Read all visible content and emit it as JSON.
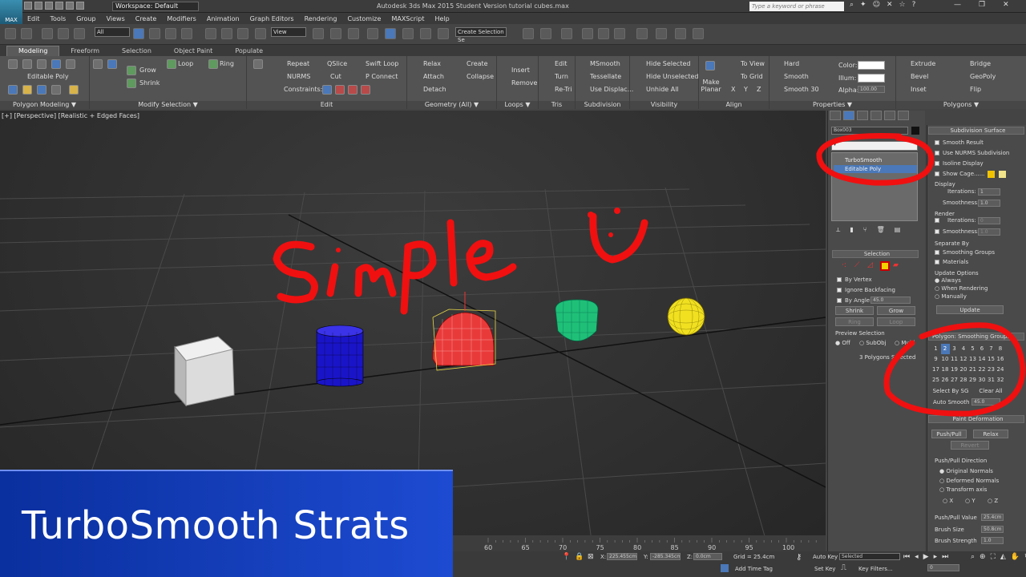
{
  "app": {
    "logo": "MAX",
    "workspace": "Workspace: Default",
    "title": "Autodesk 3ds Max  2015    Student Version    tutorial cubes.max",
    "search_placeholder": "Type a keyword or phrase"
  },
  "menu": [
    "Edit",
    "Tools",
    "Group",
    "Views",
    "Create",
    "Modifiers",
    "Animation",
    "Graph Editors",
    "Rendering",
    "Customize",
    "MAXScript",
    "Help"
  ],
  "toolbar": {
    "filter": "All",
    "ref_coord": "View",
    "selection_set": "Create Selection Se"
  },
  "ribbon_tabs": [
    "Modeling",
    "Freeform",
    "Selection",
    "Object Paint",
    "Populate"
  ],
  "ribbon": {
    "polygon_modeling": {
      "label": "Editable Poly",
      "footer": "Polygon Modeling ▼"
    },
    "modify_selection": {
      "grow": "Grow",
      "shrink": "Shrink",
      "loop": "Loop",
      "ring": "Ring",
      "footer": "Modify Selection ▼"
    },
    "edit": {
      "repeat": "Repeat",
      "qslice": "QSlice",
      "swift_loop": "Swift Loop",
      "nurms": "NURMS",
      "cut": "Cut",
      "p_connect": "P Connect",
      "constraints": "Constraints:",
      "footer": "Edit"
    },
    "geometry": {
      "relax": "Relax",
      "create": "Create",
      "attach": "Attach",
      "collapse": "Collapse",
      "detach": "Detach",
      "footer": "Geometry (All) ▼"
    },
    "loops": {
      "insert": "Insert",
      "remove": "Remove",
      "footer": "Loops ▼"
    },
    "tris": {
      "edit": "Edit",
      "turn": "Turn",
      "retri": "Re-Tri",
      "footer": "Tris"
    },
    "subdivision": {
      "msmooth": "MSmooth",
      "tessellate": "Tessellate",
      "use_displac": "Use Displac...",
      "footer": "Subdivision"
    },
    "visibility": {
      "hide_selected": "Hide Selected",
      "hide_unselected": "Hide Unselected",
      "unhide_all": "Unhide All",
      "footer": "Visibility"
    },
    "align": {
      "make_planar": "Make Planar",
      "to_view": "To View",
      "to_grid": "To Grid",
      "x": "X",
      "y": "Y",
      "z": "Z",
      "footer": "Align"
    },
    "properties": {
      "hard": "Hard",
      "smooth": "Smooth",
      "smooth30": "Smooth 30",
      "color": "Color:",
      "illum": "Illum:",
      "alpha": "Alpha:",
      "alpha_val": "100.00",
      "footer": "Properties ▼"
    },
    "polygons": {
      "extrude": "Extrude",
      "bridge": "Bridge",
      "bevel": "Bevel",
      "geopoly": "GeoPoly",
      "inset": "Inset",
      "flip": "Flip",
      "footer": "Polygons ▼"
    }
  },
  "viewport": {
    "label": "[+] [Perspective] [Realistic + Edged Faces]",
    "annotation": "simple"
  },
  "command_panel": {
    "object_name": "Box003",
    "modifiers": [
      "TurboSmooth",
      "Editable Poly"
    ],
    "selection": {
      "title": "Selection",
      "by_vertex": "By Vertex",
      "ignore_backfacing": "Ignore Backfacing",
      "by_angle": "By Angle:",
      "by_angle_val": "45.0",
      "shrink": "Shrink",
      "grow": "Grow",
      "ring": "Ring",
      "loop": "Loop",
      "preview_selection": "Preview Selection",
      "off": "Off",
      "subobj": "SubObj",
      "multi": "Multi",
      "status": "3 Polygons Selected"
    }
  },
  "rollout": {
    "subdivision_surface": {
      "title": "Subdivision Surface",
      "smooth_result": "Smooth Result",
      "use_nurms": "Use NURMS Subdivision",
      "isoline": "Isoline Display",
      "show_cage": "Show Cage......",
      "display": "Display",
      "iterations": "Iterations:",
      "iterations_val": "1",
      "smoothness": "Smoothness:",
      "smoothness_val": "1.0",
      "render": "Render",
      "r_iterations_val": "0",
      "r_smoothness_val": "1.0",
      "separate_by": "Separate By",
      "smoothing_groups": "Smoothing Groups",
      "materials": "Materials",
      "update_options": "Update Options",
      "always": "Always",
      "when_rendering": "When Rendering",
      "manually": "Manually",
      "update": "Update"
    },
    "smoothing": {
      "title": "Polygon: Smoothing Groups",
      "numbers": [
        "1",
        "2",
        "3",
        "4",
        "5",
        "6",
        "7",
        "8",
        "9",
        "10",
        "11",
        "12",
        "13",
        "14",
        "15",
        "16",
        "17",
        "18",
        "19",
        "20",
        "21",
        "22",
        "23",
        "24",
        "25",
        "26",
        "27",
        "28",
        "29",
        "30",
        "31",
        "32"
      ],
      "select_by_sg": "Select By SG",
      "clear_all": "Clear All",
      "auto_smooth": "Auto Smooth",
      "auto_smooth_val": "45.0"
    },
    "paint": {
      "title": "Paint Deformation",
      "push_pull": "Push/Pull",
      "relax": "Relax",
      "revert": "Revert",
      "direction": "Push/Pull Direction",
      "original_normals": "Original Normals",
      "deformed_normals": "Deformed Normals",
      "transform_axis": "Transform axis",
      "x": "X",
      "y": "Y",
      "z": "Z",
      "pp_value": "Push/Pull Value",
      "pp_value_val": "25.4cm",
      "brush_size": "Brush Size",
      "brush_size_val": "50.8cm",
      "brush_strength": "Brush Strength",
      "brush_strength_val": "1.0"
    }
  },
  "timeline": {
    "ticks": [
      "60",
      "65",
      "70",
      "75",
      "80",
      "85",
      "90",
      "95",
      "100"
    ]
  },
  "status": {
    "x_val": "225.455cm",
    "y_val": "-285.345cm",
    "z_val": "0.0cm",
    "grid": "Grid = 25.4cm",
    "auto_key": "Auto Key",
    "key_mode": "Selected",
    "set_key": "Set Key",
    "key_filters": "Key Filters...",
    "add_time_tag": "Add Time Tag",
    "frame": "0"
  },
  "banner": {
    "text": "TurboSmooth Strats"
  }
}
